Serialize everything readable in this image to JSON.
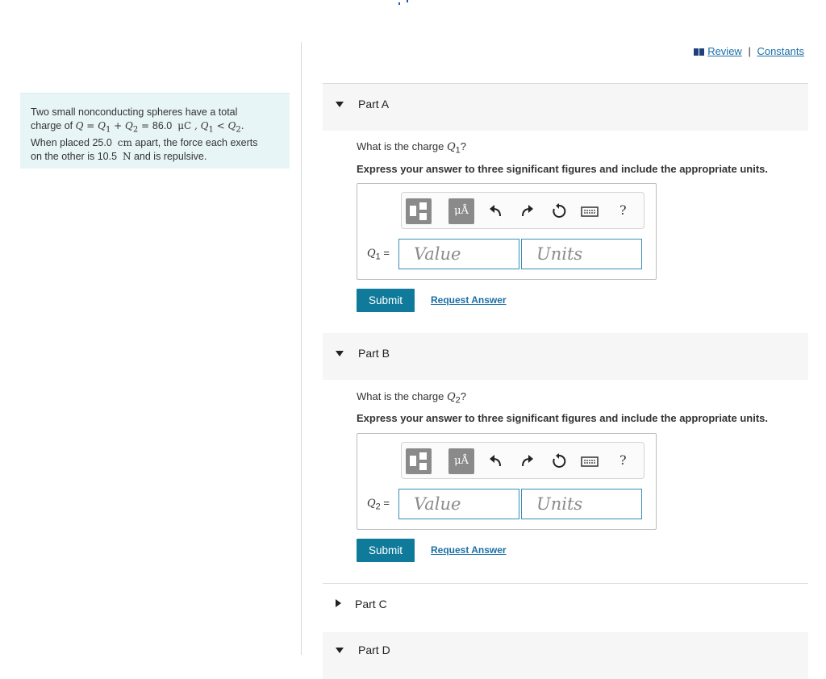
{
  "top_links": {
    "review": "Review",
    "separator": "|",
    "constants": "Constants"
  },
  "problem": {
    "line1": "Two small nonconducting spheres have a total",
    "line2_prefix": "charge of ",
    "line2_math1": "Q = Q",
    "line2_math_sub1": "1",
    "line2_math2": " + Q",
    "line2_math_sub2": "2",
    "line2_math3": " = ",
    "line2_value": "86.0",
    "line2_unit": "μC",
    "line2_ineq_a": " , Q",
    "line2_ineq_sub_a": "1",
    "line2_ineq_b": " < Q",
    "line2_ineq_sub_b": "2",
    "line2_end": ".",
    "line3_prefix": "When placed ",
    "line3_distance": "25.0",
    "line3_unit": "cm",
    "line3_suffix": " apart, the force each exerts",
    "line4_prefix": "on the other is ",
    "line4_force": "10.5",
    "line4_unit": "N",
    "line4_suffix": " and is repulsive."
  },
  "parts": [
    {
      "title": "Part A",
      "question_prefix": "What is the charge ",
      "var": "Q",
      "var_sub": "1",
      "question_suffix": "?",
      "instruction": "Express your answer to three significant figures and include the appropriate units.",
      "label_eq": "=",
      "value_placeholder": "Value",
      "units_placeholder": "Units",
      "submit": "Submit",
      "request": "Request Answer"
    },
    {
      "title": "Part B",
      "question_prefix": "What is the charge ",
      "var": "Q",
      "var_sub": "2",
      "question_suffix": "?",
      "instruction": "Express your answer to three significant figures and include the appropriate units.",
      "label_eq": "=",
      "value_placeholder": "Value",
      "units_placeholder": "Units",
      "submit": "Submit",
      "request": "Request Answer"
    },
    {
      "title": "Part C"
    },
    {
      "title": "Part D"
    }
  ],
  "toolbar": {
    "units_symbol": "μÅ",
    "help": "?"
  },
  "icons": {
    "review": "book-icon",
    "template": "fraction-template-icon",
    "units": "units-icon",
    "undo": "undo-icon",
    "redo": "redo-icon",
    "reset": "reset-icon",
    "keyboard": "keyboard-icon",
    "help": "help-icon"
  },
  "colors": {
    "accent": "#0f7a99",
    "link": "#1a6fa5",
    "problem_bg": "#e8f5f6",
    "input_border": "#3a8fb7"
  }
}
